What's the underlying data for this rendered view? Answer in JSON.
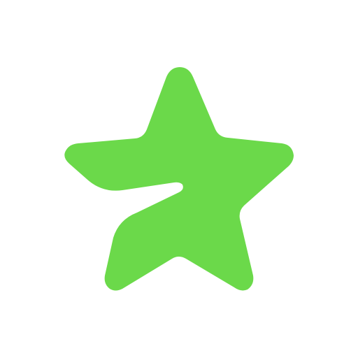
{
  "app_icon": {
    "icon": "star-logo-icon",
    "background_color": "#ffffff",
    "accent_color": "#6BD94A"
  }
}
